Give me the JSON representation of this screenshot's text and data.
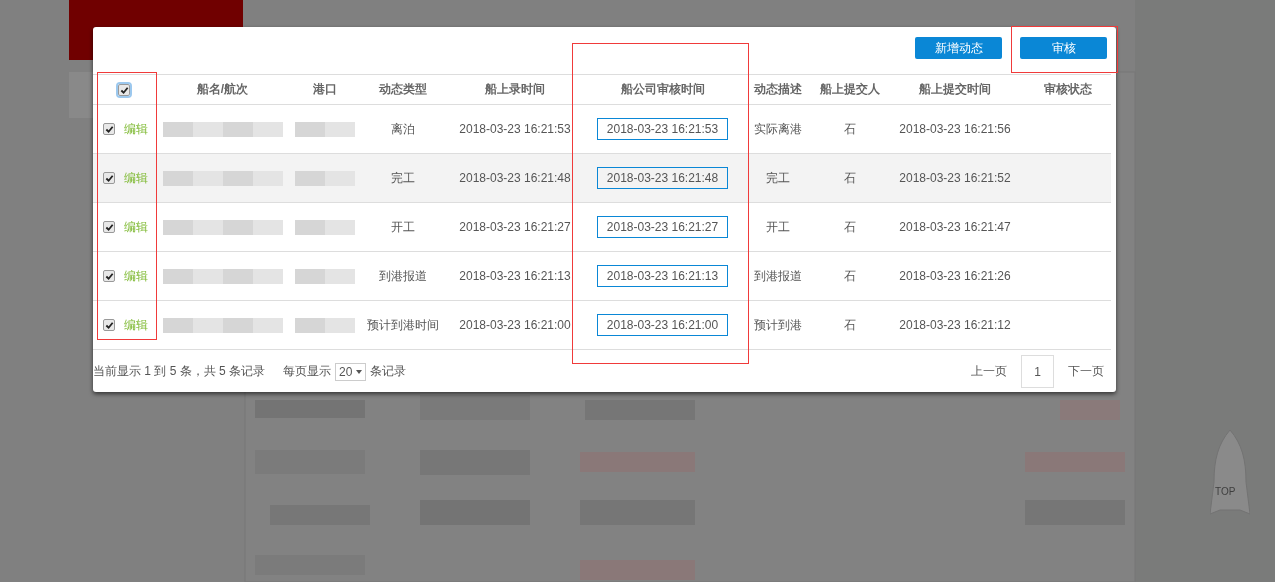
{
  "dialog": {
    "buttons": [
      "新增动态",
      "审核"
    ],
    "select_all": {
      "checked": true
    },
    "columns": [
      "船名/航次",
      "港口",
      "动态类型",
      "船上录时间",
      "船公司审核时间",
      "动态描述",
      "船上提交人",
      "船上提交时间",
      "审核状态"
    ],
    "rows": [
      {
        "checked": true,
        "highlighted": false,
        "edit": "编辑",
        "type": "离泊",
        "entry_time": "2018-03-23 16:21:53",
        "audit_time": "2018-03-23 16:21:53",
        "description": "实际离港",
        "submitter": "石",
        "submit_time": "2018-03-23 16:21:56"
      },
      {
        "checked": true,
        "highlighted": true,
        "edit": "编辑",
        "type": "完工",
        "entry_time": "2018-03-23 16:21:48",
        "audit_time": "2018-03-23 16:21:48",
        "description": "完工",
        "submitter": "石",
        "submit_time": "2018-03-23 16:21:52"
      },
      {
        "checked": true,
        "highlighted": false,
        "edit": "编辑",
        "type": "开工",
        "entry_time": "2018-03-23 16:21:27",
        "audit_time": "2018-03-23 16:21:27",
        "description": "开工",
        "submitter": "石",
        "submit_time": "2018-03-23 16:21:47"
      },
      {
        "checked": true,
        "highlighted": false,
        "edit": "编辑",
        "type": "到港报道",
        "entry_time": "2018-03-23 16:21:13",
        "audit_time": "2018-03-23 16:21:13",
        "description": "到港报道",
        "submitter": "石",
        "submit_time": "2018-03-23 16:21:26"
      },
      {
        "checked": true,
        "highlighted": false,
        "edit": "编辑",
        "type": "预计到港时间",
        "entry_time": "2018-03-23 16:21:00",
        "audit_time": "2018-03-23 16:21:00",
        "description": "预计到港",
        "submitter": "石",
        "submit_time": "2018-03-23 16:21:12"
      }
    ],
    "footer": {
      "summary": "当前显示 1 到 5 条，共 5 条记录",
      "per_page_label": "每页显示",
      "per_page": "20",
      "per_page_suffix": "条记录"
    },
    "pagination": {
      "prev": "上一页",
      "page": "1",
      "next": "下一页"
    },
    "annotations": [
      {
        "kind": "checkbox_column"
      },
      {
        "kind": "audit_time_column"
      },
      {
        "kind": "audit_button"
      }
    ]
  },
  "back_to_top": {
    "label": "TOP"
  }
}
